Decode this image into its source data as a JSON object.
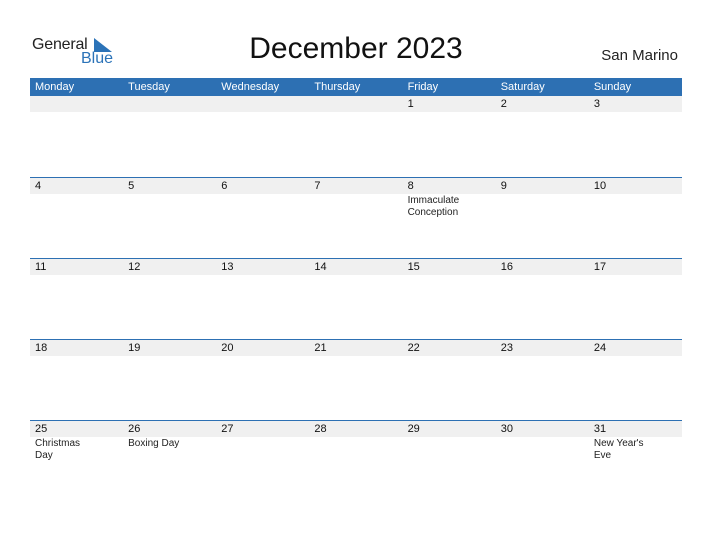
{
  "logo": {
    "word1": "General",
    "word2": "Blue"
  },
  "title": "December 2023",
  "country": "San Marino",
  "colors": {
    "accent": "#2d70b3",
    "day_strip": "#f0f0f0"
  },
  "weekdays": [
    "Monday",
    "Tuesday",
    "Wednesday",
    "Thursday",
    "Friday",
    "Saturday",
    "Sunday"
  ],
  "weeks": [
    [
      {
        "day": "",
        "holiday": ""
      },
      {
        "day": "",
        "holiday": ""
      },
      {
        "day": "",
        "holiday": ""
      },
      {
        "day": "",
        "holiday": ""
      },
      {
        "day": "1",
        "holiday": ""
      },
      {
        "day": "2",
        "holiday": ""
      },
      {
        "day": "3",
        "holiday": ""
      }
    ],
    [
      {
        "day": "4",
        "holiday": ""
      },
      {
        "day": "5",
        "holiday": ""
      },
      {
        "day": "6",
        "holiday": ""
      },
      {
        "day": "7",
        "holiday": ""
      },
      {
        "day": "8",
        "holiday": "Immaculate Conception"
      },
      {
        "day": "9",
        "holiday": ""
      },
      {
        "day": "10",
        "holiday": ""
      }
    ],
    [
      {
        "day": "11",
        "holiday": ""
      },
      {
        "day": "12",
        "holiday": ""
      },
      {
        "day": "13",
        "holiday": ""
      },
      {
        "day": "14",
        "holiday": ""
      },
      {
        "day": "15",
        "holiday": ""
      },
      {
        "day": "16",
        "holiday": ""
      },
      {
        "day": "17",
        "holiday": ""
      }
    ],
    [
      {
        "day": "18",
        "holiday": ""
      },
      {
        "day": "19",
        "holiday": ""
      },
      {
        "day": "20",
        "holiday": ""
      },
      {
        "day": "21",
        "holiday": ""
      },
      {
        "day": "22",
        "holiday": ""
      },
      {
        "day": "23",
        "holiday": ""
      },
      {
        "day": "24",
        "holiday": ""
      }
    ],
    [
      {
        "day": "25",
        "holiday": "Christmas Day"
      },
      {
        "day": "26",
        "holiday": "Boxing Day"
      },
      {
        "day": "27",
        "holiday": ""
      },
      {
        "day": "28",
        "holiday": ""
      },
      {
        "day": "29",
        "holiday": ""
      },
      {
        "day": "30",
        "holiday": ""
      },
      {
        "day": "31",
        "holiday": "New Year's Eve"
      }
    ]
  ]
}
